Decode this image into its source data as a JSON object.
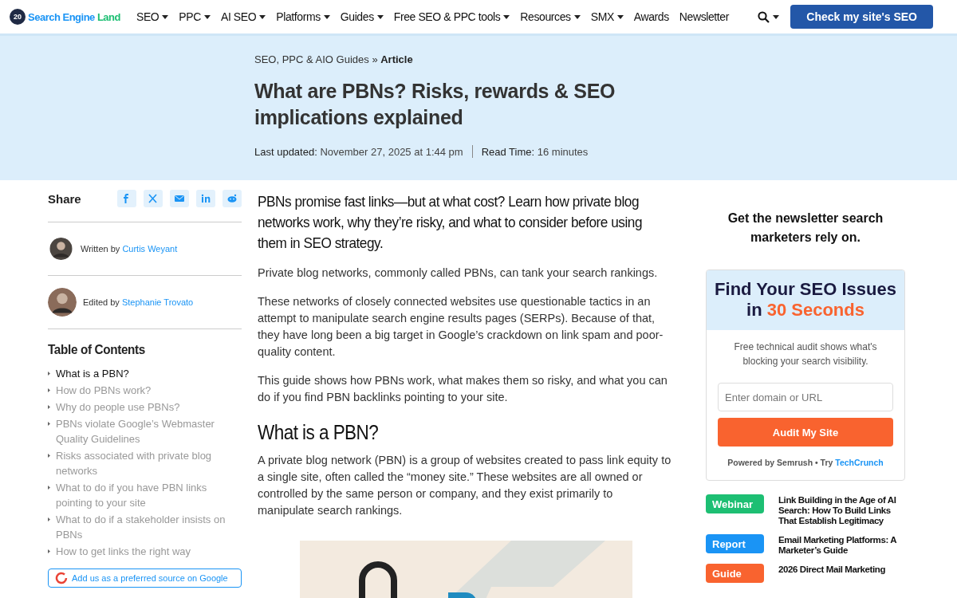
{
  "header": {
    "logo_badge": "20",
    "logo_main": "Search Engine",
    "logo_accent": "Land",
    "nav": [
      {
        "label": "SEO",
        "dropdown": true
      },
      {
        "label": "PPC",
        "dropdown": true
      },
      {
        "label": "AI SEO",
        "dropdown": true
      },
      {
        "label": "Platforms",
        "dropdown": true
      },
      {
        "label": "Guides",
        "dropdown": true
      },
      {
        "label": "Free SEO & PPC tools",
        "dropdown": true
      },
      {
        "label": "Resources",
        "dropdown": true
      },
      {
        "label": "SMX",
        "dropdown": true
      },
      {
        "label": "Awards",
        "dropdown": false
      },
      {
        "label": "Newsletter",
        "dropdown": false
      }
    ],
    "cta": "Check my site's SEO"
  },
  "hero": {
    "breadcrumb": "SEO, PPC & AIO Guides",
    "breadcrumb_sep": "»",
    "breadcrumb_current": "Article",
    "title": "What are PBNs? Risks, rewards & SEO implications explained",
    "updated_label": "Last updated:",
    "updated": "November 27, 2025 at 1:44 pm",
    "read_label": "Read Time:",
    "read": "16 minutes"
  },
  "sidebar": {
    "share_label": "Share",
    "people": [
      {
        "role": "Written by",
        "name": "Curtis Weyant"
      },
      {
        "role": "Edited by",
        "name": "Stephanie Trovato"
      }
    ],
    "toc_title": "Table of Contents",
    "toc": [
      {
        "label": "What is a PBN?",
        "selected": true
      },
      {
        "label": "How do PBNs work?",
        "selected": false
      },
      {
        "label": "Why do people use PBNs?",
        "selected": false
      },
      {
        "label": "PBNs violate Google’s Webmaster Quality Guidelines",
        "selected": false
      },
      {
        "label": "Risks associated with private blog networks",
        "selected": false
      },
      {
        "label": "What to do if you have PBN links pointing to your site",
        "selected": false
      },
      {
        "label": "What to do if a stakeholder insists on PBNs",
        "selected": false
      },
      {
        "label": "How to get links the right way",
        "selected": false
      }
    ],
    "google_button": "Add us as a preferred source on Google"
  },
  "article": {
    "lede": "PBNs promise fast links—but at what cost? Learn how private blog networks work, why they’re risky, and what to consider before using them in SEO strategy.",
    "blocks": [
      {
        "kind": "paragraph",
        "text": "Private blog networks, commonly called PBNs, can tank your search rankings."
      },
      {
        "kind": "paragraph",
        "text": "These networks of closely connected websites use questionable tactics in an attempt to manipulate search engine results pages (SERPs). Because of that, they have long been a big target in Google’s crackdown on link spam and poor-quality content."
      },
      {
        "kind": "paragraph",
        "text": "This guide shows how PBNs work, what makes them so risky, and what you can do if you find PBN backlinks pointing to your site."
      },
      {
        "kind": "heading",
        "text": "What is a PBN?"
      },
      {
        "kind": "paragraph",
        "text": "A private blog network (PBN) is a group of websites created to pass link equity to a single site, often called the “money site.” These websites are all owned or controlled by the same person or company, and they exist primarily to manipulate search rankings."
      },
      {
        "kind": "picture"
      }
    ]
  },
  "rail": {
    "newsletter": "Get the newsletter search marketers rely on.",
    "promo": {
      "title": "Find Your SEO Issues in",
      "highlight": "30 Seconds",
      "text": "Free technical audit shows what's blocking your search visibility.",
      "placeholder": "Enter domain or URL",
      "button": "Audit My Site",
      "powered": "Powered by Semrush • Try",
      "link": "TechCrunch"
    },
    "resources": [
      {
        "tag": "Webinar",
        "color": "#1dbf73",
        "title": "Link Building in the Age of AI Search: How To Build Links That Establish Legitimacy"
      },
      {
        "tag": "Report",
        "color": "#1a94f5",
        "title": "Email Marketing Platforms: A Marketer’s Guide"
      },
      {
        "tag": "Guide",
        "color": "#f9632f",
        "title": "2026 Direct Mail Marketing"
      }
    ]
  }
}
